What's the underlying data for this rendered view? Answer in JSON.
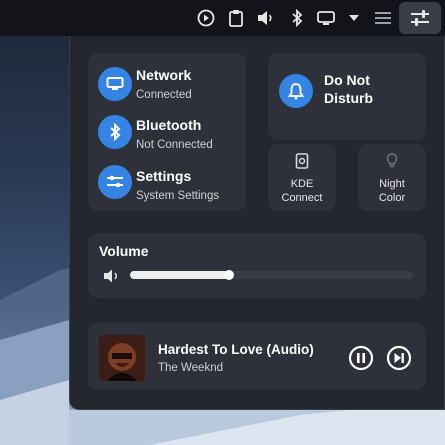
{
  "topbar": {
    "icons": [
      "record-icon",
      "clipboard-icon",
      "volume-icon",
      "bluetooth-icon",
      "display-icon",
      "chevron-down-icon",
      "menu-icon",
      "quick-settings-icon"
    ]
  },
  "network": {
    "title": "Network",
    "status": "Connected"
  },
  "bluetooth": {
    "title": "Bluetooth",
    "status": "Not Connected"
  },
  "settings": {
    "title": "Settings",
    "status": "System Settings"
  },
  "dnd": {
    "title_line1": "Do Not",
    "title_line2": "Disturb"
  },
  "kde": {
    "line1": "KDE",
    "line2": "Connect"
  },
  "night": {
    "line1": "Night",
    "line2": "Color"
  },
  "volume": {
    "title": "Volume",
    "level": 0.35
  },
  "media": {
    "title": "Hardest To Love (Audio)",
    "artist": "The Weeknd"
  },
  "colors": {
    "accent": "#3584e4",
    "panel": "#24272e",
    "card": "#2e3139"
  }
}
